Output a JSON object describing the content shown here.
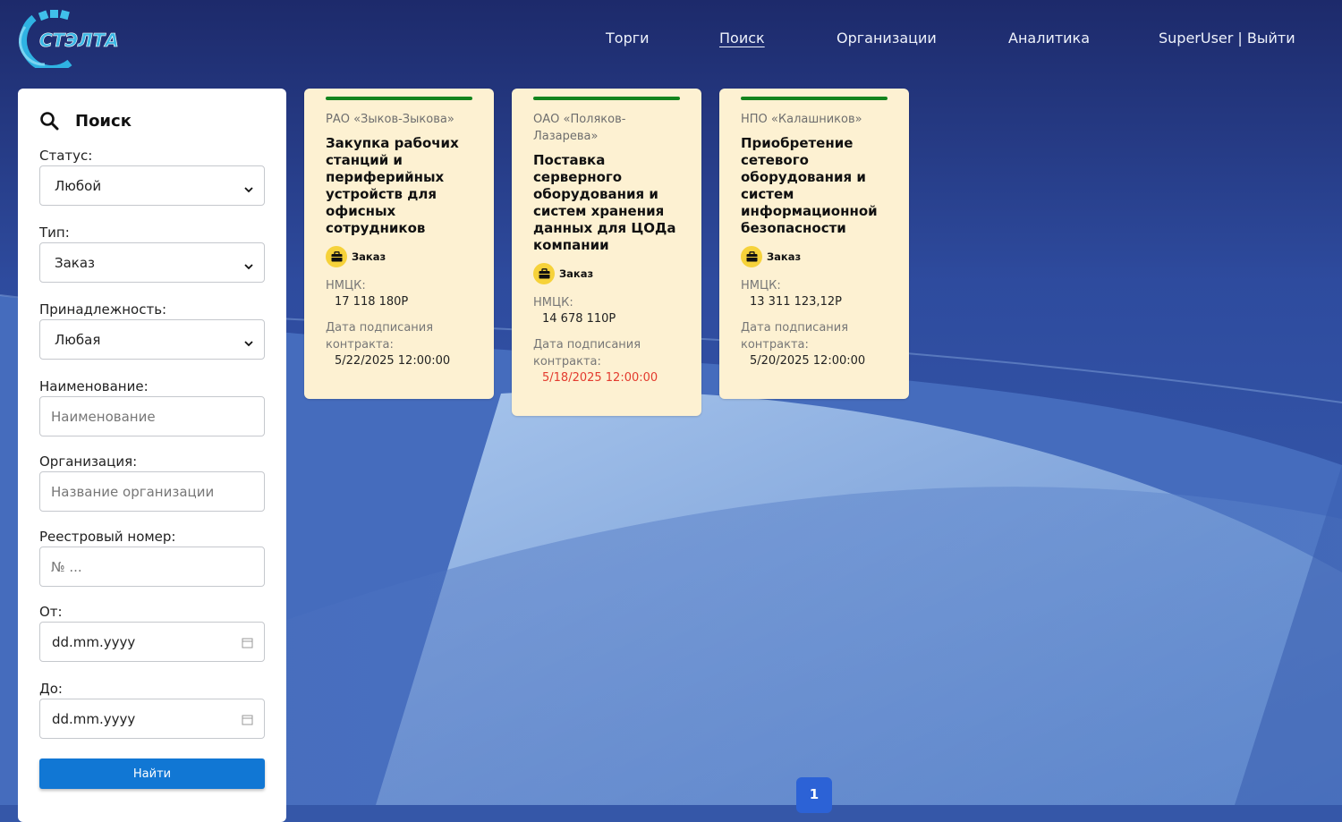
{
  "header": {
    "logo_text": "СТЭЛТА",
    "nav": [
      {
        "label": "Торги",
        "active": false
      },
      {
        "label": "Поиск",
        "active": true
      },
      {
        "label": "Организации",
        "active": false
      },
      {
        "label": "Аналитика",
        "active": false
      },
      {
        "label": "SuperUser | Выйти",
        "active": false
      }
    ]
  },
  "search": {
    "title": "Поиск",
    "status": {
      "label": "Статус:",
      "value": "Любой"
    },
    "type": {
      "label": "Тип:",
      "value": "Заказ"
    },
    "ownership": {
      "label": "Принадлежность:",
      "value": "Любая"
    },
    "name": {
      "label": "Наименование:",
      "placeholder": "Наименование"
    },
    "organization": {
      "label": "Организация:",
      "placeholder": "Название организации"
    },
    "registry": {
      "label": "Реестровый номер:",
      "placeholder": "№ ..."
    },
    "from": {
      "label": "От:",
      "value": "dd.mm.yyyy"
    },
    "to": {
      "label": "До:",
      "value": "dd.mm.yyyy"
    },
    "submit_label": "Найти"
  },
  "cards": [
    {
      "org": "РАО «Зыков-Зыкова»",
      "title": "Закупка рабочих станций и периферийных устройств для офисных сотрудников",
      "type": "Заказ",
      "price_label": "НМЦК:",
      "price": "17 118 180Р",
      "date_label": "Дата подписания контракта:",
      "date": "5/22/2025 12:00:00",
      "date_overdue": false
    },
    {
      "org": "ОАО «Поляков-Лазарева»",
      "title": "Поставка серверного оборудования и систем хранения данных для ЦОДа компании",
      "type": "Заказ",
      "price_label": "НМЦК:",
      "price": "14 678 110Р",
      "date_label": "Дата подписания контракта:",
      "date": "5/18/2025 12:00:00",
      "date_overdue": true
    },
    {
      "org": "НПО «Калашников»",
      "title": "Приобретение сетевого оборудования и систем информационной безопасности",
      "type": "Заказ",
      "price_label": "НМЦК:",
      "price": "13 311 123,12Р",
      "date_label": "Дата подписания контракта:",
      "date": "5/20/2025 12:00:00",
      "date_overdue": false
    }
  ],
  "pagination": {
    "current": "1"
  },
  "colors": {
    "card_bg": "#fdf1d2",
    "card_bar": "#13841d",
    "overdue": "#e33b2e",
    "button": "#1177d4",
    "page_active": "#2c62d6"
  }
}
